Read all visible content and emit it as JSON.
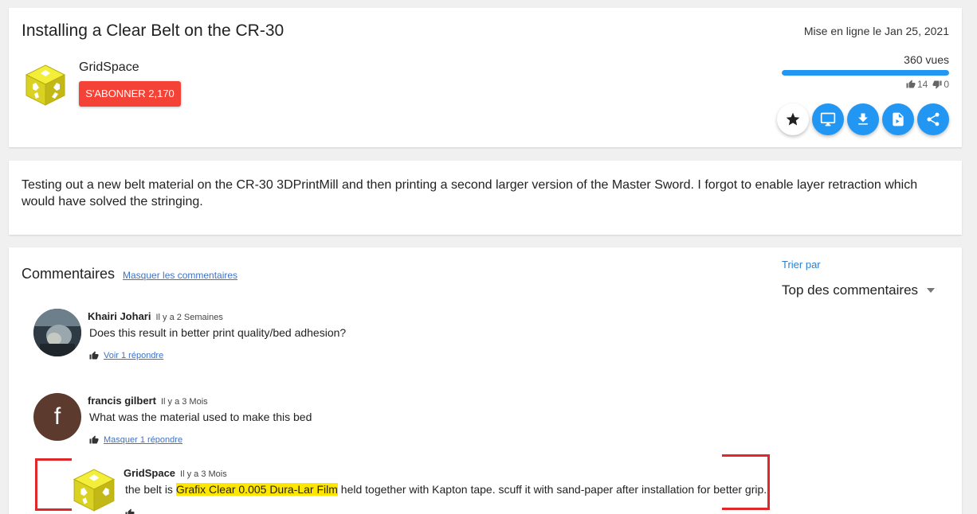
{
  "video": {
    "title": "Installing a Clear Belt on the CR-30",
    "published": "Mise en ligne le Jan 25, 2021",
    "views": "360 vues",
    "likes": "14",
    "dislikes": "0",
    "like_ratio": 1.0
  },
  "channel": {
    "name": "GridSpace",
    "subscribe_label": "S'ABONNER 2,170"
  },
  "actions": [
    "favorite-icon",
    "monitor-icon",
    "download-icon",
    "file-icon",
    "share-icon"
  ],
  "description": "Testing out a new belt material on the CR-30 3DPrintMill and then printing a second larger version of the Master Sword. I forgot to enable layer retraction which would have solved the stringing.",
  "comments_section": {
    "title": "Commentaires",
    "hide_label": "Masquer les commentaires",
    "sort_label": "Trier par",
    "sort_value": "Top des commentaires"
  },
  "comments": [
    {
      "author": "Khairi Johari",
      "time": "Il y a 2 Semaines",
      "body": "Does this result in better print quality/bed adhesion?",
      "replies_label": "Voir 1 répondre"
    },
    {
      "author": "francis gilbert",
      "time": "Il y a 3 Mois",
      "body": "What was the material used to make this bed",
      "replies_label": "Masquer 1 répondre",
      "avatar_letter": "f"
    }
  ],
  "reply": {
    "author": "GridSpace",
    "time": "Il y a 3 Mois",
    "body_before": "the belt is ",
    "body_highlight": "Grafix Clear 0.005 Dura-Lar Film",
    "body_after": " held together with Kapton tape. scuff it with sand-paper after installation for better grip."
  },
  "colors": {
    "accent": "#2196f3",
    "subscribe": "#f44336",
    "link": "#3f72c4",
    "highlight": "#ffe600",
    "annotation": "#e0272a"
  }
}
